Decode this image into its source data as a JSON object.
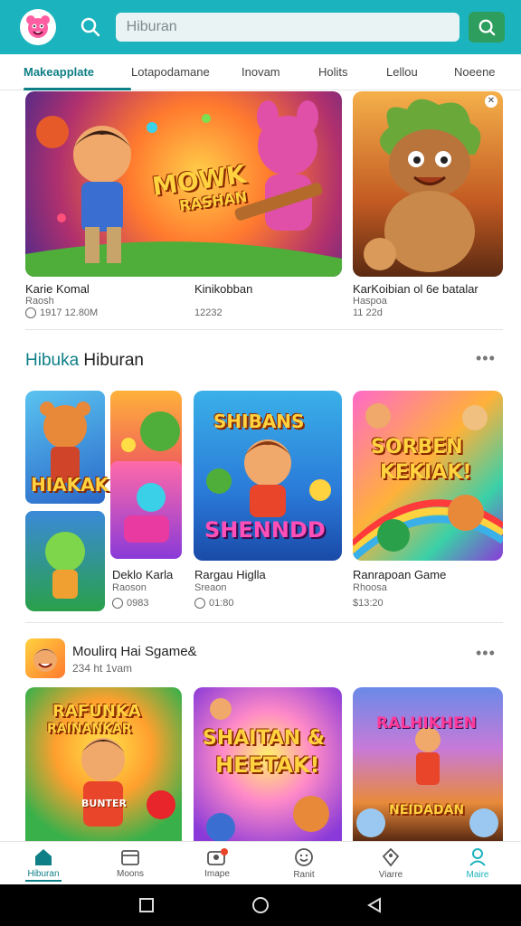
{
  "header": {
    "search_placeholder": "Hiburan"
  },
  "tabs": [
    {
      "label": "Makeapplate",
      "active": true
    },
    {
      "label": "Lotapodamane",
      "active": false
    },
    {
      "label": "Inovam",
      "active": false
    },
    {
      "label": "Holits",
      "active": false
    },
    {
      "label": "Lellou",
      "active": false
    },
    {
      "label": "Noeene",
      "active": false
    }
  ],
  "featured": {
    "items": [
      {
        "title": "Karie Komal",
        "subtitle": "Raosh",
        "meta": "1917 12.80M",
        "art_text": [
          "MOWK",
          "RASHAN"
        ]
      },
      {
        "title": "Kinikobban",
        "subtitle": "",
        "meta": "12232"
      },
      {
        "title": "KarKoibian ol 6e batalar",
        "subtitle": "Haspoa",
        "meta": "11 22d"
      }
    ]
  },
  "section1": {
    "title_accent": "Hibuka",
    "title_rest": " Hiburan",
    "items": [
      {
        "title": "Deklo Karla",
        "subtitle": "Raoson",
        "meta": "0983",
        "art_text": [
          "HIAKAK"
        ]
      },
      {
        "title": "Rargau Higlla",
        "subtitle": "Sreaon",
        "meta": "01:80",
        "art_text": [
          "SHIBANS",
          "SHENNDD"
        ]
      },
      {
        "title": "Ranrapoan Game",
        "subtitle": "Rhoosa",
        "meta": "$13:20",
        "art_text": [
          "SORBEN",
          "KEKIAK!"
        ]
      }
    ]
  },
  "section2": {
    "title": "Moulirq Hai Sgame&",
    "subtitle": "234 ht 1vam",
    "items": [
      {
        "art_text": [
          "RAFUNKA",
          "RAINANKAR"
        ],
        "art_sub": "BUNTER"
      },
      {
        "art_text": [
          "SHAITAN &",
          "HEETAK!"
        ]
      },
      {
        "art_text": [
          "RALHIKHEN"
        ],
        "art_sub": "NEIDADAN"
      }
    ]
  },
  "bottom_nav": [
    {
      "label": "Hiburan",
      "icon": "home-icon",
      "active": true
    },
    {
      "label": "Moons",
      "icon": "calendar-icon",
      "active": false
    },
    {
      "label": "Imape",
      "icon": "profile-badge-icon",
      "active": false
    },
    {
      "label": "Ranit",
      "icon": "smiley-icon",
      "active": false
    },
    {
      "label": "Viarre",
      "icon": "tag-icon",
      "active": false
    },
    {
      "label": "Maire",
      "icon": "user-icon",
      "active": false
    }
  ],
  "colors": {
    "primary": "#1bb3bd",
    "accent": "#0e7f86",
    "search_button": "#2e9e5e"
  }
}
